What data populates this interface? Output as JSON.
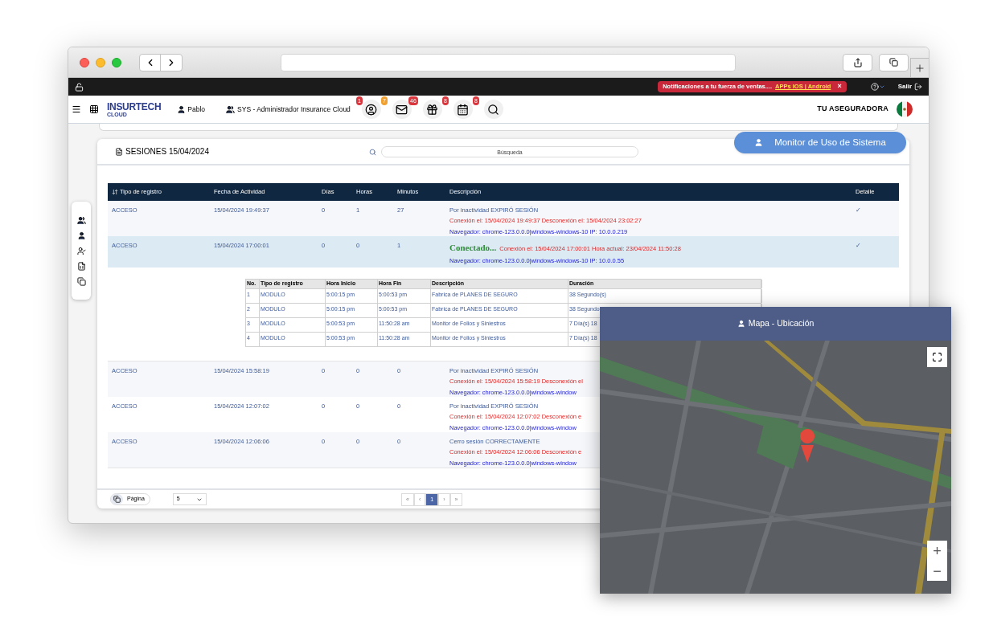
{
  "topbar": {
    "notification": {
      "text": "Notificaciones a tu fuerza de ventas....",
      "link": "APPs IOS | Android",
      "close": "×"
    },
    "logout": "Salir"
  },
  "header": {
    "logo": {
      "name": "INSURTECH",
      "sub": "CLOUD"
    },
    "user": "Pablo",
    "role": "SYS - Administrador Insurance Cloud",
    "company": "TU ASEGURADORA",
    "icons": [
      {
        "kind": "user",
        "badges": [
          {
            "text": "1",
            "color": "#d9363e"
          },
          {
            "text": "7",
            "color": "#f0a030"
          }
        ]
      },
      {
        "kind": "mail",
        "badges": [
          {
            "text": "46",
            "color": "#d9363e"
          }
        ]
      },
      {
        "kind": "gift",
        "badges": [
          {
            "text": "8",
            "color": "#d9363e"
          }
        ]
      },
      {
        "kind": "calendar",
        "badges": [
          {
            "text": "8",
            "color": "#d9363e"
          }
        ]
      },
      {
        "kind": "search"
      }
    ]
  },
  "monitor_button": "Monitor de Uso de Sistema",
  "sessions": {
    "title": "SESIONES 15/04/2024",
    "search": {
      "placeholder": "Búsqueda"
    },
    "columns": [
      "Tipo de registro",
      "Fecha de Actividad",
      "Días",
      "Horas",
      "Minutos",
      "Descripción",
      "Detalle"
    ],
    "rows": [
      {
        "type": "ACCESO",
        "date": "15/04/2024 19:49:37",
        "days": "0",
        "hours": "1",
        "minutes": "27",
        "selected": false,
        "detail": "✓",
        "lines": [
          [
            {
              "kind": "status",
              "text": "Por inactividad EXPIRÓ SESIÓN"
            }
          ],
          [
            {
              "kind": "connection",
              "text": "Conexión el: 15/04/2024 19:49:37 Desconexión el: 15/04/2024 23:02:27"
            }
          ],
          [
            {
              "kind": "browser",
              "text": "Navegador: chrome-123.0.0.0|windows-windows-10 IP: 10.0.0.219"
            }
          ]
        ]
      },
      {
        "type": "ACCESO",
        "date": "15/04/2024 17:00:01",
        "days": "0",
        "hours": "0",
        "minutes": "1",
        "selected": true,
        "detail": "✓",
        "lines": [
          [
            {
              "kind": "connected",
              "text": "Conectado..."
            },
            {
              "kind": "connection",
              "text": "Conexión el: 15/04/2024 17:00:01 Hora actual: 23/04/2024 11:50:28"
            }
          ],
          [
            {
              "kind": "browser",
              "text": "Navegador: chrome-123.0.0.0|windows-windows-10 IP: 10.0.0.55"
            }
          ]
        ],
        "details": {
          "columns": [
            "No.",
            "Tipo de registro",
            "Hora Inicio",
            "Hora Fin",
            "Descripción",
            "Duración"
          ],
          "rows": [
            [
              "1",
              "MODULO",
              "5:00:15 pm",
              "5:00:53 pm",
              "Fabrica de PLANES DE SEGURO",
              "38 Segundo(s)"
            ],
            [
              "2",
              "MODULO",
              "5:00:15 pm",
              "5:00:53 pm",
              "Fabrica de PLANES DE SEGURO",
              "38 Segundo"
            ],
            [
              "3",
              "MODULO",
              "5:00:53 pm",
              "11:50:28 am",
              "Monitor de Folios y Siniestros",
              "7 Día(s) 18"
            ],
            [
              "4",
              "MODULO",
              "5:00:53 pm",
              "11:50:28 am",
              "Monitor de Folios y Siniestros",
              "7 Día(s) 18"
            ]
          ]
        }
      },
      {
        "type": "ACCESO",
        "date": "15/04/2024 15:58:19",
        "days": "0",
        "hours": "0",
        "minutes": "0",
        "selected": false,
        "lines": [
          [
            {
              "kind": "status",
              "text": "Por inactividad EXPIRÓ SESIÓN"
            }
          ],
          [
            {
              "kind": "connection",
              "text": "Conexión el: 15/04/2024 15:58:19 Desconexión el"
            }
          ],
          [
            {
              "kind": "browser",
              "text": "Navegador: chrome-123.0.0.0|windows-window"
            }
          ]
        ]
      },
      {
        "type": "ACCESO",
        "date": "15/04/2024 12:07:02",
        "days": "0",
        "hours": "0",
        "minutes": "0",
        "selected": false,
        "lines": [
          [
            {
              "kind": "status",
              "text": "Por inactividad EXPIRÓ SESIÓN"
            }
          ],
          [
            {
              "kind": "connection",
              "text": "Conexión el: 15/04/2024 12:07:02 Desconexión e"
            }
          ],
          [
            {
              "kind": "browser",
              "text": "Navegador: chrome-123.0.0.0|windows-window"
            }
          ]
        ]
      },
      {
        "type": "ACCESO",
        "date": "15/04/2024 12:06:06",
        "days": "0",
        "hours": "0",
        "minutes": "0",
        "selected": false,
        "lines": [
          [
            {
              "kind": "status",
              "text": "Cerro sesión CORRECTAMENTE"
            }
          ],
          [
            {
              "kind": "connection",
              "text": "Conexión el: 15/04/2024 12:06:06 Desconexión e"
            }
          ],
          [
            {
              "kind": "browser",
              "text": "Navegador: chrome-123.0.0.0|windows-window"
            }
          ]
        ]
      }
    ],
    "footer": {
      "page_label": "Página",
      "page_size": "5",
      "pages": [
        {
          "label": "«",
          "selected": false
        },
        {
          "label": "‹",
          "selected": false
        },
        {
          "label": "1",
          "selected": true
        },
        {
          "label": "›",
          "selected": false
        },
        {
          "label": "»",
          "selected": false
        }
      ]
    }
  },
  "map": {
    "title": "Mapa - Ubicación",
    "zoom_in": "+",
    "zoom_out": "−"
  }
}
